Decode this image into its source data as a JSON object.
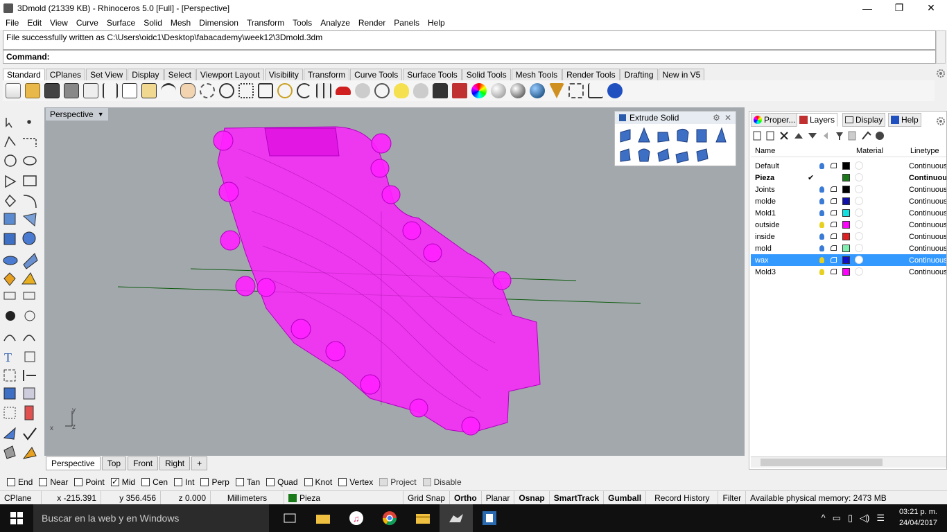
{
  "window": {
    "title": "3Dmold (21339 KB) - Rhinoceros 5.0 [Full] - [Perspective]",
    "minimize": "—",
    "maximize": "❐",
    "close": "✕"
  },
  "menu": [
    "File",
    "Edit",
    "View",
    "Curve",
    "Surface",
    "Solid",
    "Mesh",
    "Dimension",
    "Transform",
    "Tools",
    "Analyze",
    "Render",
    "Panels",
    "Help"
  ],
  "command": {
    "history": "File successfully written as C:\\Users\\oidc1\\Desktop\\fabacademy\\week12\\3Dmold.3dm",
    "prompt": "Command:"
  },
  "toolbar_tabs": [
    "Standard",
    "CPlanes",
    "Set View",
    "Display",
    "Select",
    "Viewport Layout",
    "Visibility",
    "Transform",
    "Curve Tools",
    "Surface Tools",
    "Solid Tools",
    "Mesh Tools",
    "Render Tools",
    "Drafting",
    "New in V5"
  ],
  "viewport": {
    "label": "Perspective",
    "axis_x": "x",
    "axis_y": "y",
    "axis_z": "z"
  },
  "viewport_tabs": [
    "Perspective",
    "Top",
    "Front",
    "Right"
  ],
  "viewport_add": "+",
  "extrude_panel": {
    "title": "Extrude Solid"
  },
  "right_panel": {
    "tabs": [
      "Proper...",
      "Layers",
      "Display",
      "Help"
    ],
    "columns": {
      "name": "Name",
      "material": "Material",
      "linetype": "Linetype"
    },
    "layers": [
      {
        "name": "Default",
        "color": "#000000",
        "linetype": "Continuous",
        "current": false,
        "selected": false,
        "bulb": "#3a7bd5"
      },
      {
        "name": "Pieza",
        "color": "#1a7a1a",
        "linetype": "Continuous",
        "current": true,
        "selected": false,
        "bulb": ""
      },
      {
        "name": "Joints",
        "color": "#000000",
        "linetype": "Continuous",
        "current": false,
        "selected": false,
        "bulb": "#3a7bd5"
      },
      {
        "name": "molde",
        "color": "#1010aa",
        "linetype": "Continuous",
        "current": false,
        "selected": false,
        "bulb": "#3a7bd5"
      },
      {
        "name": "Mold1",
        "color": "#10e0e0",
        "linetype": "Continuous",
        "current": false,
        "selected": false,
        "bulb": "#3a7bd5"
      },
      {
        "name": "outside",
        "color": "#ff00ff",
        "linetype": "Continuous",
        "current": false,
        "selected": false,
        "bulb": "#e8d020"
      },
      {
        "name": "inside",
        "color": "#e02020",
        "linetype": "Continuous",
        "current": false,
        "selected": false,
        "bulb": "#3a7bd5"
      },
      {
        "name": "mold",
        "color": "#80f0b0",
        "linetype": "Continuous",
        "current": false,
        "selected": false,
        "bulb": "#3a7bd5"
      },
      {
        "name": "wax",
        "color": "#1010cc",
        "linetype": "Continuous",
        "current": false,
        "selected": true,
        "bulb": "#e8d020"
      },
      {
        "name": "Mold3",
        "color": "#ff00ff",
        "linetype": "Continuous",
        "current": false,
        "selected": false,
        "bulb": "#e8d020"
      }
    ],
    "current_mark": "✔"
  },
  "osnaps": [
    {
      "label": "End",
      "checked": false,
      "disabled": false
    },
    {
      "label": "Near",
      "checked": false,
      "disabled": false
    },
    {
      "label": "Point",
      "checked": false,
      "disabled": false
    },
    {
      "label": "Mid",
      "checked": true,
      "disabled": false
    },
    {
      "label": "Cen",
      "checked": false,
      "disabled": false
    },
    {
      "label": "Int",
      "checked": false,
      "disabled": false
    },
    {
      "label": "Perp",
      "checked": false,
      "disabled": false
    },
    {
      "label": "Tan",
      "checked": false,
      "disabled": false
    },
    {
      "label": "Quad",
      "checked": false,
      "disabled": false
    },
    {
      "label": "Knot",
      "checked": false,
      "disabled": false
    },
    {
      "label": "Vertex",
      "checked": false,
      "disabled": false
    },
    {
      "label": "Project",
      "checked": false,
      "disabled": true
    },
    {
      "label": "Disable",
      "checked": false,
      "disabled": true
    }
  ],
  "checkmark": "✓",
  "status": {
    "cplane": "CPlane",
    "x": "x -215.391",
    "y": "y 356.456",
    "z": "z 0.000",
    "units": "Millimeters",
    "layer": "Pieza",
    "layer_color": "#1a7a1a",
    "grid_snap": "Grid Snap",
    "ortho": "Ortho",
    "planar": "Planar",
    "osnap": "Osnap",
    "smarttrack": "SmartTrack",
    "gumball": "Gumball",
    "record_history": "Record History",
    "filter": "Filter",
    "memory": "Available physical memory: 2473 MB"
  },
  "taskbar": {
    "search": "Buscar en la web y en Windows",
    "time": "03:21 p. m.",
    "date": "24/04/2017"
  },
  "colors": {
    "model": "#ff20ff",
    "viewport_bg": "#a3a8ad",
    "selection": "#3399ff"
  }
}
